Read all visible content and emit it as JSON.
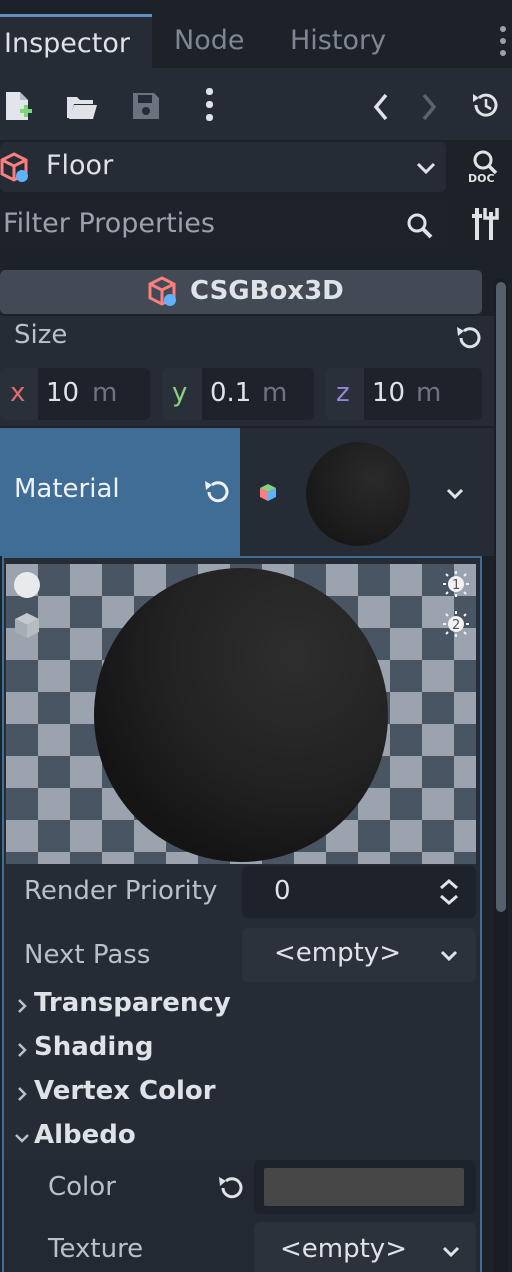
{
  "tabs": [
    {
      "label": "Inspector",
      "active": true
    },
    {
      "label": "Node",
      "active": false
    },
    {
      "label": "History",
      "active": false
    }
  ],
  "toolbar": {
    "icons": [
      "new-resource-icon",
      "open-folder-icon",
      "save-icon",
      "more-vert-icon",
      "back-icon",
      "forward-icon",
      "history-icon"
    ]
  },
  "object_selector": {
    "name": "Floor"
  },
  "doc_label": "DOC",
  "filter": {
    "placeholder": "Filter Properties"
  },
  "section": {
    "title": "CSGBox3D"
  },
  "size": {
    "label": "Size",
    "x_axis": "x",
    "x_value": "10",
    "x_unit": "m",
    "y_axis": "y",
    "y_value": "0.1",
    "y_unit": "m",
    "z_axis": "z",
    "z_value": "10",
    "z_unit": "m"
  },
  "material": {
    "label": "Material"
  },
  "render_priority": {
    "label": "Render Priority",
    "value": "0"
  },
  "next_pass": {
    "label": "Next Pass",
    "value": "<empty>"
  },
  "groups": [
    {
      "label": "Transparency",
      "expanded": false
    },
    {
      "label": "Shading",
      "expanded": false
    },
    {
      "label": "Vertex Color",
      "expanded": false
    },
    {
      "label": "Albedo",
      "expanded": true
    }
  ],
  "albedo": {
    "color_label": "Color",
    "color_value": "#464646",
    "texture_label": "Texture",
    "texture_value": "<empty>"
  },
  "colors": {
    "accent": "#5f90c2",
    "material_highlight": "#3f6d96",
    "axis_x": "#e06d6d",
    "axis_y": "#8ad07f",
    "axis_z": "#8f87d8"
  }
}
